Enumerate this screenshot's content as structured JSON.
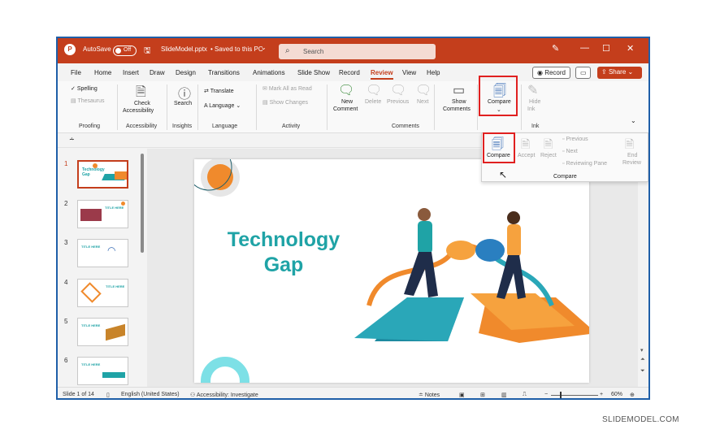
{
  "titlebar": {
    "autosave_label": "AutoSave",
    "autosave_state": "Off",
    "file_name": "SlideModel.pptx",
    "save_status": "• Saved to this PC",
    "save_status_chevron": "⌄",
    "search_placeholder": "Search",
    "pen_icon": "✎",
    "min_icon": "—",
    "max_icon": "☐",
    "close_icon": "✕"
  },
  "menu": {
    "tabs": [
      "File",
      "Home",
      "Insert",
      "Draw",
      "Design",
      "Transitions",
      "Animations",
      "Slide Show",
      "Record",
      "Review",
      "View",
      "Help"
    ],
    "active_tab": "Review",
    "record_button": "Record",
    "share_button": "Share"
  },
  "ribbon": {
    "proofing": {
      "spelling": "Spelling",
      "thesaurus": "Thesaurus",
      "group": "Proofing"
    },
    "accessibility": {
      "check_line1": "Check",
      "check_line2": "Accessibility",
      "group": "Accessibility"
    },
    "insights": {
      "search": "Search",
      "group": "Insights"
    },
    "language": {
      "translate": "Translate",
      "language": "Language",
      "group": "Language"
    },
    "activity": {
      "mark_all": "Mark All as Read",
      "show_changes": "Show Changes",
      "group": "Activity"
    },
    "comments": {
      "new_line1": "New",
      "new_line2": "Comment",
      "delete": "Delete",
      "previous": "Previous",
      "next": "Next",
      "show_line1": "Show",
      "show_line2": "Comments",
      "group": "Comments"
    },
    "compare": {
      "label": "Compare"
    },
    "ink": {
      "hide_line1": "Hide",
      "hide_line2": "Ink",
      "group": "Ink"
    }
  },
  "dropdown": {
    "compare": "Compare",
    "accept": "Accept",
    "reject": "Reject",
    "previous": "Previous",
    "next": "Next",
    "reviewing_pane": "Reviewing Pane",
    "end_line1": "End",
    "end_line2": "Review",
    "group": "Compare"
  },
  "thumbnails": {
    "numbers": [
      "1",
      "2",
      "3",
      "4",
      "5",
      "6"
    ],
    "slide1_title_line1": "Technology",
    "slide1_title_line2": "Gap",
    "slide_title_small": "TITLE HERE"
  },
  "slide": {
    "title_line1": "Technology",
    "title_line2": "Gap"
  },
  "status": {
    "slide_count": "Slide 1 of 14",
    "language": "English (United States)",
    "accessibility": "Accessibility: Investigate",
    "notes": "Notes",
    "zoom": "60%",
    "zoom_minus": "−",
    "zoom_plus": "+"
  },
  "watermark": "SLIDEMODEL.COM",
  "colors": {
    "accent": "#c43e1c",
    "title_teal": "#1fa3a6",
    "highlight_red": "#e02020",
    "orange": "#f08a2c"
  }
}
